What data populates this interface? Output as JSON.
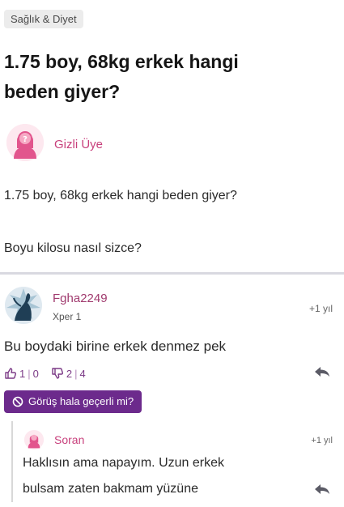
{
  "question": {
    "category": "Sağlık & Diyet",
    "title_line1": "1.75 boy, 68kg erkek hangi",
    "title_line2": "beden giyer?",
    "asker_name": "Gizli Üye",
    "body_line1": "1.75 boy, 68kg erkek hangi beden giyer?",
    "body_line2": "Boyu kilosu nasıl sizce?"
  },
  "answer": {
    "username": "Fgha2249",
    "level": "Xper 1",
    "time": "+1 yıl",
    "text": "Bu boydaki birine erkek denmez pek",
    "likes": "1",
    "like_second": "0",
    "dislikes": "2",
    "dislike_second": "4",
    "opinion_button": "Görüş hala geçerli mi?"
  },
  "reply": {
    "username": "Soran",
    "time": "+1 yıl",
    "text_line1": "Haklısın ama napayım. Uzun erkek",
    "text_line2": "bulsam zaten bakmam yüzüne"
  },
  "icons": {
    "like": "thumbs-up-icon",
    "dislike": "thumbs-down-icon",
    "reply": "reply-arrow-icon",
    "ban": "ban-icon",
    "avatar_female": "female-avatar-icon"
  },
  "colors": {
    "accent_purple": "#6c2a8c",
    "username_pink": "#c8407c",
    "vote_purple": "#7b3a86"
  }
}
